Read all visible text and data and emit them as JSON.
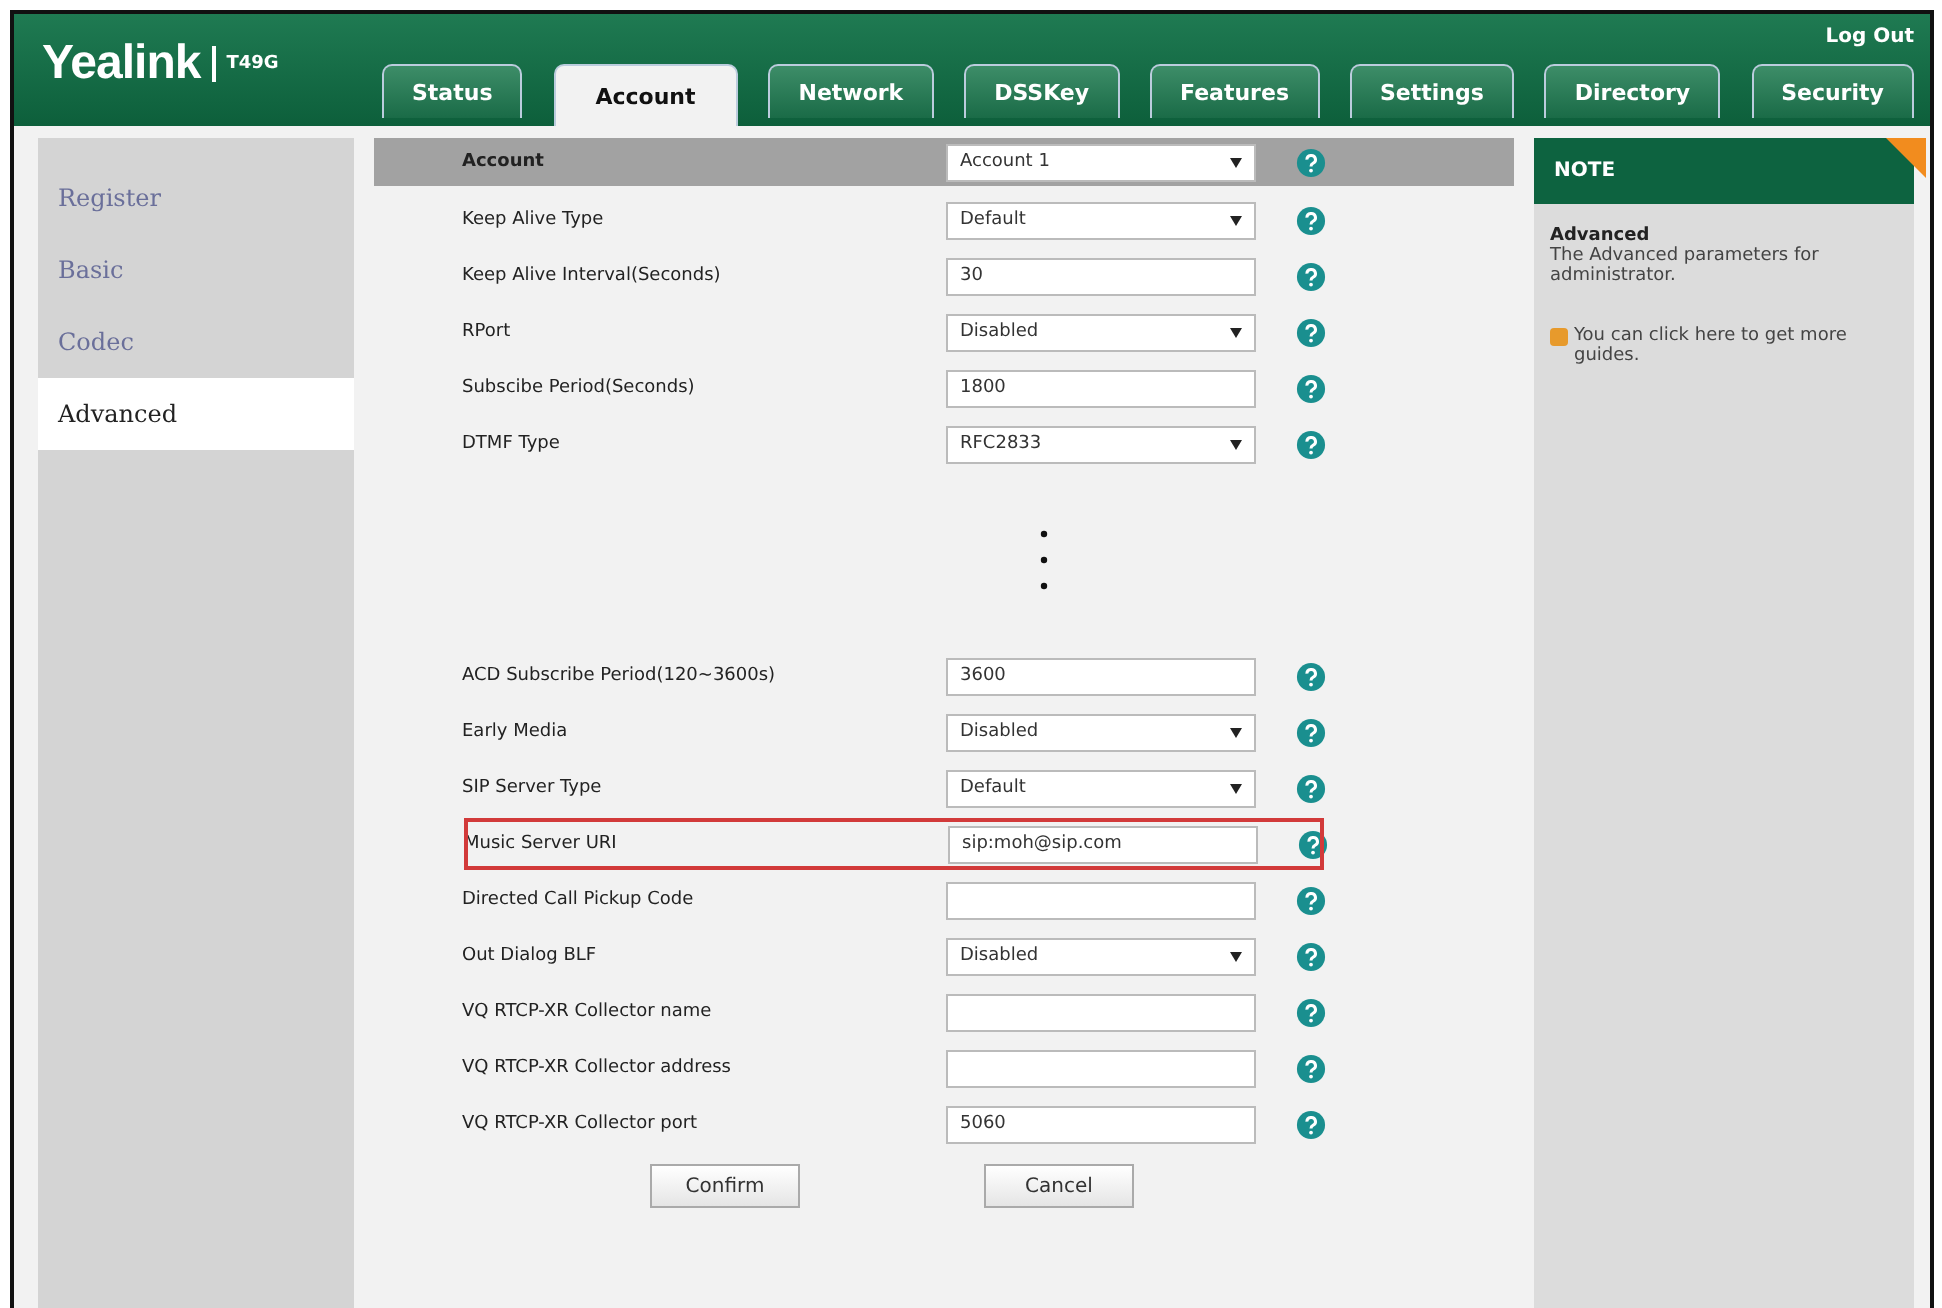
{
  "header": {
    "logo": "Yealink",
    "model": "T49G",
    "logout": "Log Out"
  },
  "tabs": [
    {
      "label": "Status",
      "selected": false
    },
    {
      "label": "Account",
      "selected": true
    },
    {
      "label": "Network",
      "selected": false
    },
    {
      "label": "DSSKey",
      "selected": false
    },
    {
      "label": "Features",
      "selected": false
    },
    {
      "label": "Settings",
      "selected": false
    },
    {
      "label": "Directory",
      "selected": false
    },
    {
      "label": "Security",
      "selected": false
    }
  ],
  "sidebar": {
    "items": [
      {
        "label": "Register",
        "selected": false
      },
      {
        "label": "Basic",
        "selected": false
      },
      {
        "label": "Codec",
        "selected": false
      },
      {
        "label": "Advanced",
        "selected": true
      }
    ]
  },
  "form": {
    "account_row": {
      "label": "Account",
      "value": "Account 1"
    },
    "rows_top": [
      {
        "label": "Keep Alive Type",
        "kind": "select",
        "value": "Default",
        "highlighted": false
      },
      {
        "label": "Keep Alive Interval(Seconds)",
        "kind": "text",
        "value": "30",
        "highlighted": false
      },
      {
        "label": "RPort",
        "kind": "select",
        "value": "Disabled",
        "highlighted": false
      },
      {
        "label": "Subscibe Period(Seconds)",
        "kind": "text",
        "value": "1800",
        "highlighted": false
      },
      {
        "label": "DTMF Type",
        "kind": "select",
        "value": "RFC2833",
        "highlighted": false
      }
    ],
    "rows_bottom": [
      {
        "label": "ACD Subscribe Period(120~3600s)",
        "kind": "text",
        "value": "3600",
        "highlighted": false
      },
      {
        "label": "Early Media",
        "kind": "select",
        "value": "Disabled",
        "highlighted": false
      },
      {
        "label": "SIP Server Type",
        "kind": "select",
        "value": "Default",
        "highlighted": false
      },
      {
        "label": "Music Server URI",
        "kind": "text",
        "value": "sip:moh@sip.com",
        "highlighted": true
      },
      {
        "label": "Directed Call Pickup Code",
        "kind": "text",
        "highlighted": false
      },
      {
        "label": "Out Dialog BLF",
        "kind": "select",
        "value": "Disabled",
        "highlighted": false
      },
      {
        "label": "VQ RTCP-XR Collector name",
        "kind": "text",
        "highlighted": false
      },
      {
        "label": "VQ RTCP-XR Collector address",
        "kind": "text",
        "highlighted": false
      },
      {
        "label": "VQ RTCP-XR Collector port",
        "kind": "text",
        "value": "5060",
        "highlighted": false
      }
    ],
    "buttons": [
      "Confirm",
      "Cancel"
    ]
  },
  "note": {
    "title": "NOTE",
    "heading": "Advanced",
    "text": "The Advanced parameters for administrator.",
    "guide": "You can click here to get more guides."
  }
}
